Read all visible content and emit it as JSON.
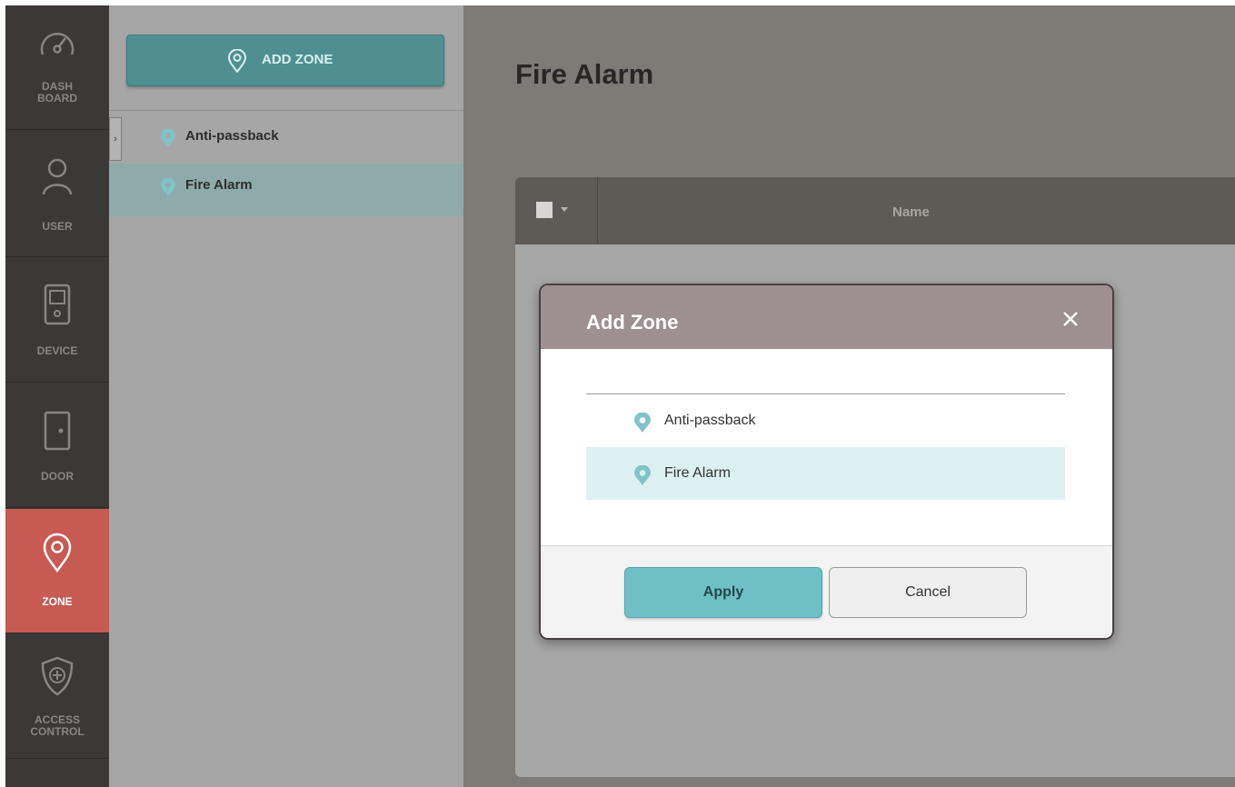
{
  "nav": {
    "items": [
      {
        "label": "DASH\nBOARD",
        "icon": "gauge-icon"
      },
      {
        "label": "USER",
        "icon": "user-icon"
      },
      {
        "label": "DEVICE",
        "icon": "device-icon"
      },
      {
        "label": "DOOR",
        "icon": "door-icon"
      },
      {
        "label": "ZONE",
        "icon": "zone-icon",
        "active": true
      },
      {
        "label": "ACCESS\nCONTROL",
        "icon": "access-control-icon"
      }
    ]
  },
  "zone_panel": {
    "add_button_label": "ADD ZONE",
    "tree": [
      {
        "label": "Anti-passback"
      },
      {
        "label": "Fire Alarm",
        "selected": true
      }
    ]
  },
  "main": {
    "title": "Fire Alarm",
    "table": {
      "columns": [
        "Name"
      ]
    }
  },
  "modal": {
    "title": "Add Zone",
    "items": [
      {
        "label": "Anti-passback"
      },
      {
        "label": "Fire Alarm",
        "selected": true
      }
    ],
    "apply_label": "Apply",
    "cancel_label": "Cancel"
  },
  "colors": {
    "accent": "#6fc0c6",
    "nav_active": "#c75a52",
    "pin": "#7fc4c8"
  }
}
